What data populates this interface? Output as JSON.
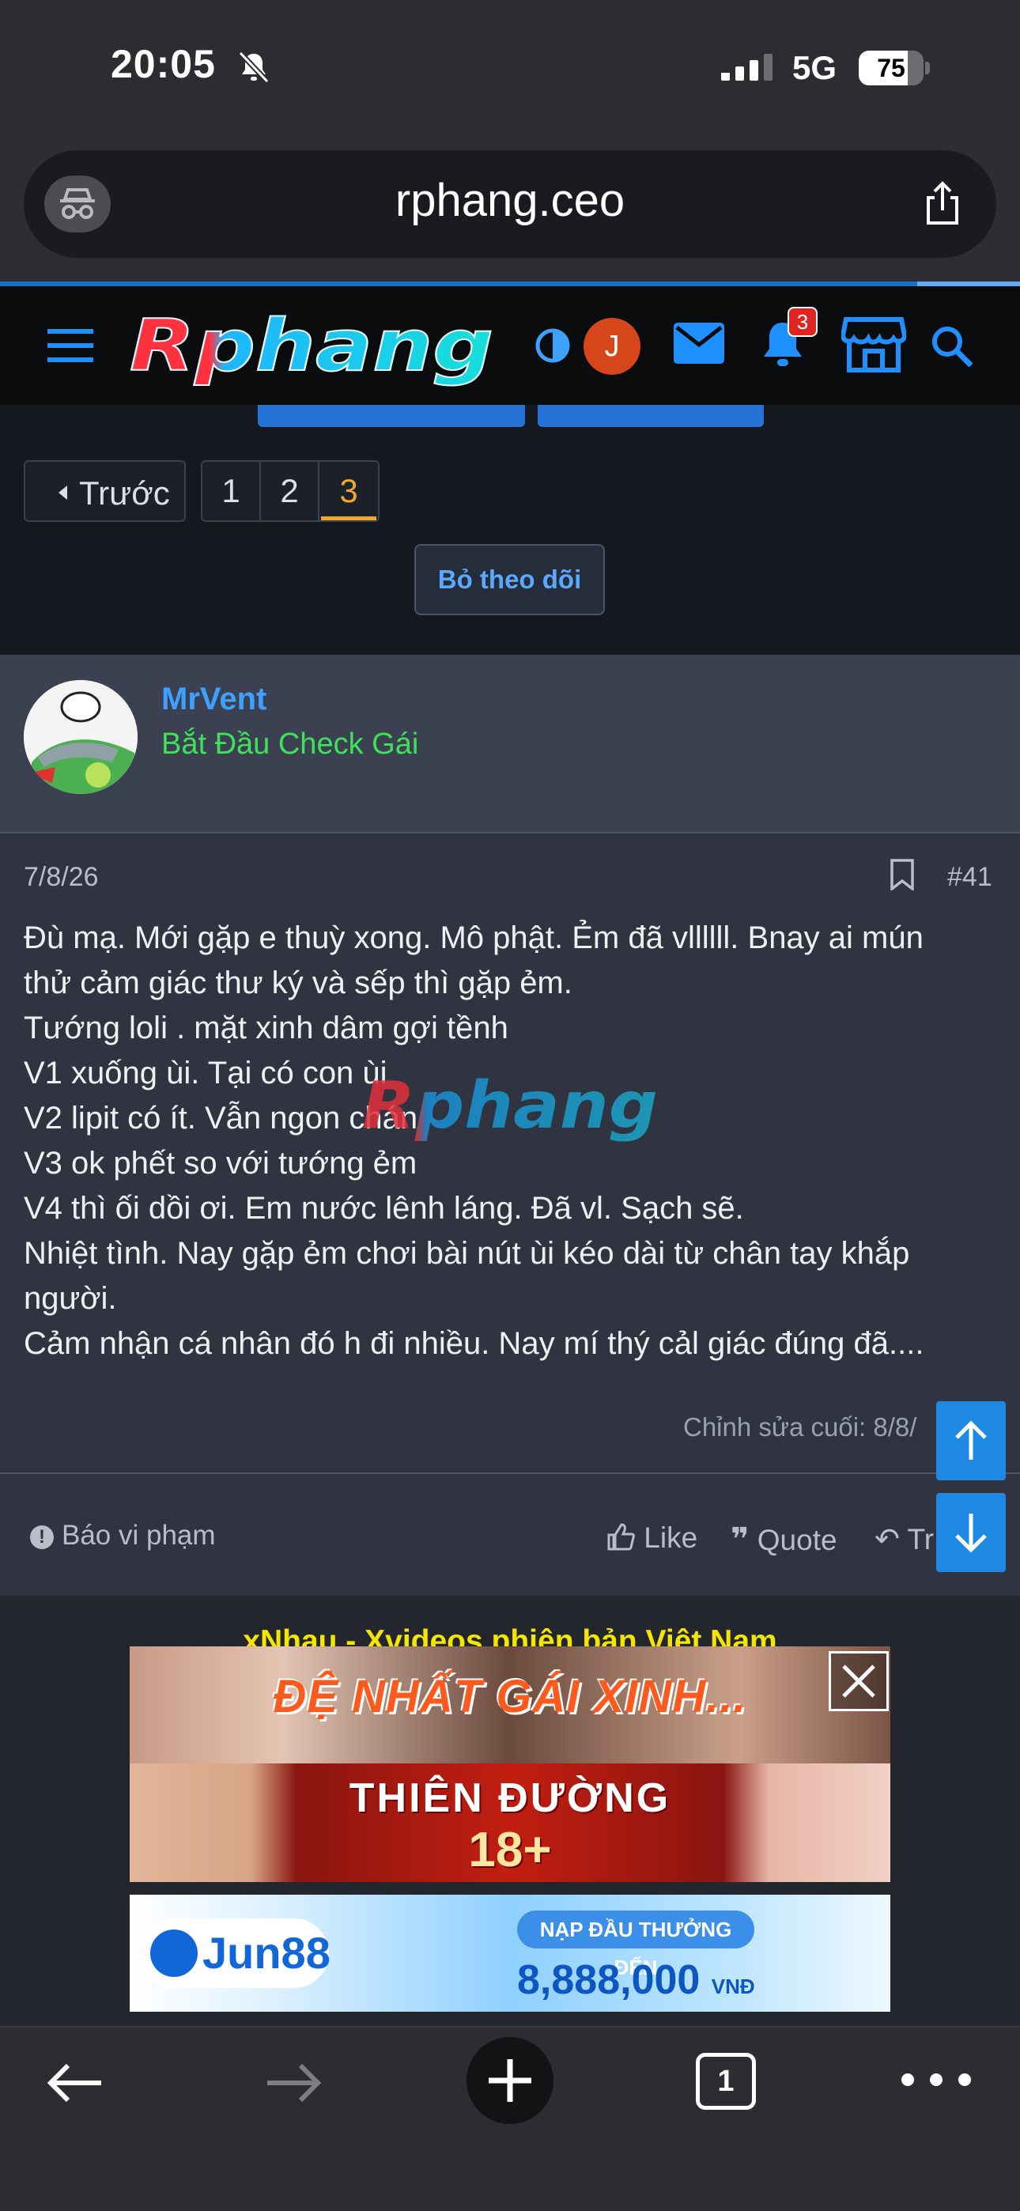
{
  "status_bar": {
    "time": "20:05",
    "network": "5G",
    "battery": "75",
    "battery_level": 0.75
  },
  "browser": {
    "url": "rphang.ceo",
    "tab_count": "1"
  },
  "site": {
    "logo_text": "Rphang",
    "avatar_letter": "J",
    "notification_count": "3"
  },
  "pagination": {
    "prev_label": "Trước",
    "pages": [
      "1",
      "2",
      "3"
    ],
    "current_page": "3"
  },
  "thread": {
    "unfollow_label": "Bỏ theo dõi"
  },
  "post": {
    "username": "MrVent",
    "user_title": "Bắt Đầu Check Gái",
    "date": "7/8/26",
    "number": "#41",
    "body_lines": [
      "Đù mạ. Mới gặp e thuỳ xong. Mô phật. Ẻm đã vllllll. Bnay ai mún",
      "thử cảm giác thư ký và sếp thì gặp ẻm.",
      "Tướng loli . mặt xinh dâm gợi tềnh",
      "V1 xuống ùi. Tại có con ùi",
      "V2 lipit có ít. Vẫn ngon chán",
      "V3 ok phết so với tướng ẻm",
      "V4 thì ối dồi ơi. Em nước lênh láng. Đã vl. Sạch sẽ.",
      "Nhiệt tình. Nay gặp ẻm chơi bài nút ùi kéo dài từ chân tay khắp",
      "người.",
      "Cảm nhận cá nhân đó h đi nhiều. Nay mí thý cảl giác đúng đã...."
    ],
    "watermark": "Rphang",
    "edited": "Chỉnh sửa cuối: 8/8/",
    "report_label": "Báo vi phạm",
    "like_label": "Like",
    "quote_label": "Quote",
    "reply_label": "Tr"
  },
  "ads": {
    "title": "xNhau - Xvideos phiên bản Việt Nam",
    "ad1_text": "ĐỆ NHẤT GÁI XINH...",
    "ad2_line1": "THIÊN ĐƯỜNG",
    "ad2_line2": "18+",
    "ad3_brand": "Jun88",
    "ad3_pill": "NẠP ĐẦU THƯỞNG ĐẾN",
    "ad3_amount": "8,888,000",
    "ad3_currency": "VNĐ"
  },
  "icons": {
    "menu": "hamburger-icon",
    "theme": "half-circle-icon",
    "messages": "mail-icon",
    "alerts": "bell-icon",
    "store": "store-icon",
    "search": "search-icon"
  },
  "colors": {
    "accent": "#3da2ff",
    "user_title": "#3ee25a",
    "current_page": "#f0a62a",
    "ad_title": "#f5e600"
  }
}
